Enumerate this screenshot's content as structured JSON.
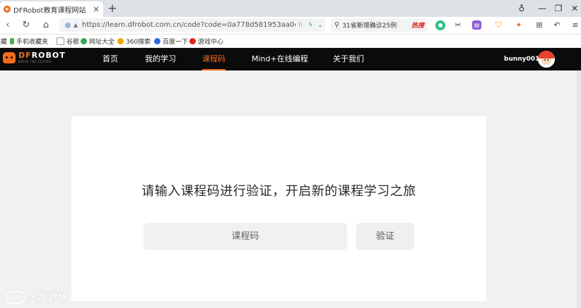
{
  "browser": {
    "tab_title": "DFRobot教育课程网站",
    "tab_favicon_letter": "e",
    "url": "https://learn.dfrobot.com.cn/code?code=0a778d581953aa0e775",
    "search_text": "31省新增确诊25例",
    "search_hot": "热搜"
  },
  "bookmarks": [
    {
      "label": "收藏",
      "color": "#ffffff"
    },
    {
      "label": "手机收藏夹",
      "color": "#4caf50"
    },
    {
      "label": "谷歌",
      "color": "#cccccc"
    },
    {
      "label": "网址大全",
      "color": "#34a853"
    },
    {
      "label": "360搜索",
      "color": "#f0a500"
    },
    {
      "label": "百度一下",
      "color": "#2b6de0"
    },
    {
      "label": "游戏中心",
      "color": "#e2231a"
    }
  ],
  "site": {
    "brand_df": "DF",
    "brand_rest": "ROBOT",
    "slogan": "DRIVE THE FUTURE",
    "nav": [
      {
        "label": "首页",
        "active": false
      },
      {
        "label": "我的学习",
        "active": false
      },
      {
        "label": "课程码",
        "active": true
      },
      {
        "label": "Mind+在线编程",
        "active": false
      },
      {
        "label": "关于我们",
        "active": false
      }
    ],
    "username": "bunny001"
  },
  "main": {
    "headline": "请输入课程码进行验证，开启新的课程学习之旅",
    "code_placeholder": "课程码",
    "code_value": "",
    "verify_label": "验证"
  },
  "watermark": "大散跨境",
  "colors": {
    "accent": "#f26b1d",
    "header_bg": "#0b0b0b",
    "page_bg": "#f1f1f1"
  }
}
